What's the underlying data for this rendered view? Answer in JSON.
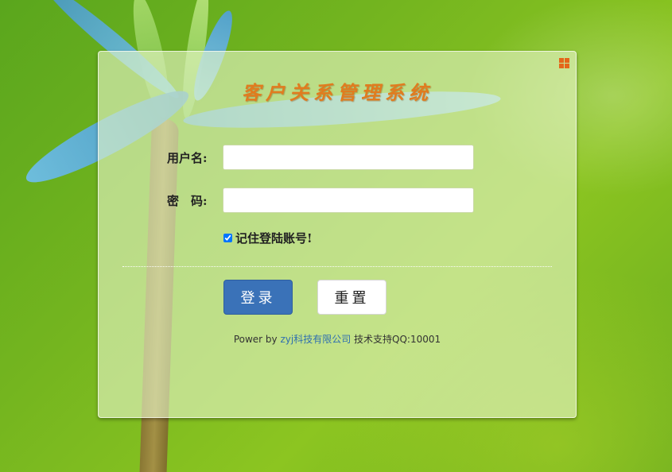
{
  "app": {
    "title": "客户关系管理系统"
  },
  "form": {
    "username_label": "用户名:",
    "username_value": "",
    "password_label": "密　码:",
    "password_value": "",
    "remember_label": "记住登陆账号!",
    "remember_checked": true
  },
  "buttons": {
    "login_label": "登录",
    "reset_label": "重置"
  },
  "footer": {
    "prefix": "Power by ",
    "company_link": "zyj科技有限公司",
    "support": " 技术支持QQ:10001"
  },
  "colors": {
    "title": "#e07c1f",
    "login_button": "#3a72b8",
    "corner_icon": "#e4661a",
    "link": "#2f6fb0"
  },
  "icons": {
    "corner": "grid-icon"
  }
}
